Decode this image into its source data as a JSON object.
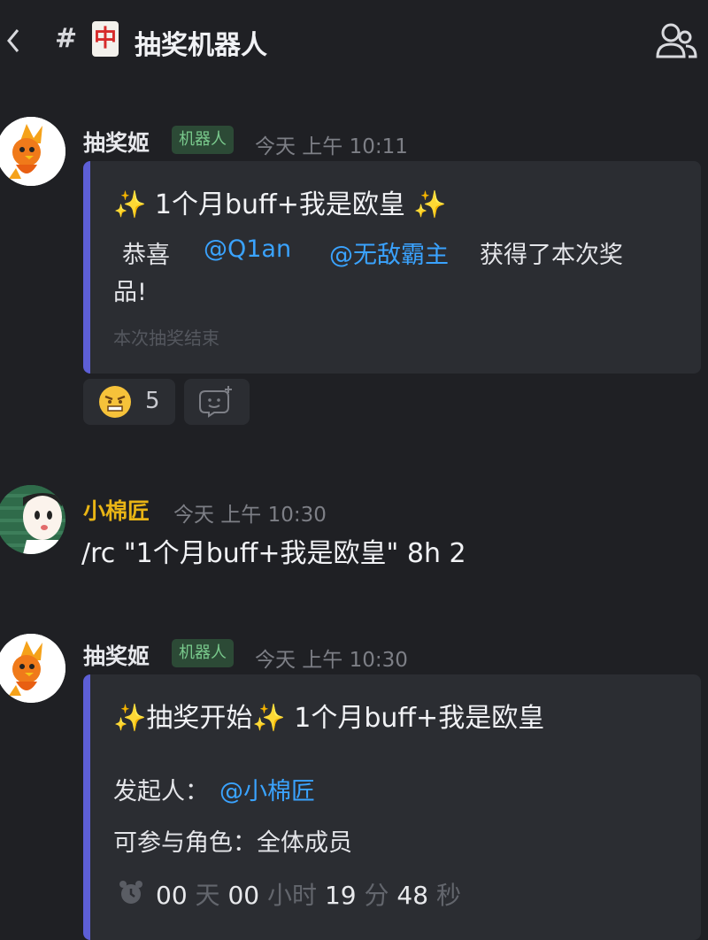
{
  "header": {
    "hash": "#",
    "mahjong_char": "中",
    "channel_title": "抽奖机器人"
  },
  "messages": [
    {
      "author": "抽奖姬",
      "badge": "机器人",
      "time": "今天 上午 10:11",
      "embed": {
        "title": "✨ 1个月buff+我是欧皇 ✨",
        "congrats": "恭喜",
        "mention1": "@Q1an",
        "mention2": "@无敌霸主",
        "result_line1_suffix": "获得了本次奖",
        "result_line2": "品!",
        "footer": "本次抽奖结束"
      },
      "reaction_count": "5"
    },
    {
      "author": "小棉匠",
      "time": "今天 上午 10:30",
      "text": "/rc \"1个月buff+我是欧皇\" 8h 2"
    },
    {
      "author": "抽奖姬",
      "badge": "机器人",
      "time": "今天 上午 10:30",
      "embed": {
        "title": "✨抽奖开始✨ 1个月buff+我是欧皇",
        "initiator_label": "发起人：",
        "initiator_mention": "@小棉匠",
        "roles_line": "可参与角色：全体成员",
        "countdown": {
          "days": "00",
          "days_unit": "天",
          "hours": "00",
          "hours_unit": "小时",
          "minutes": "19",
          "minutes_unit": "分",
          "seconds": "48",
          "seconds_unit": "秒"
        }
      }
    }
  ],
  "colors": {
    "background": "#1f2024",
    "embed_bar": "#5d5fd6",
    "mention": "#3aa3ff",
    "bot_badge": "#79c98c",
    "author_gold": "#e9b515"
  },
  "icons": {
    "back": "chevron-left-icon",
    "members": "members-icon",
    "reaction": "angry-face-emoji",
    "add_reaction": "add-reaction-icon",
    "alarm": "alarm-clock-icon"
  }
}
